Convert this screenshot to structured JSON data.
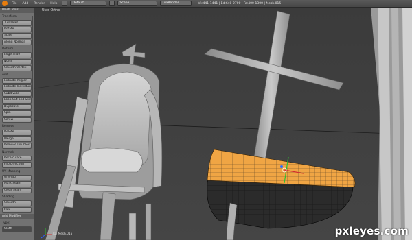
{
  "topbar": {
    "menus": [
      "File",
      "Add",
      "Render",
      "Help"
    ],
    "layout": "Default",
    "scene": "Scene",
    "engine": "LuxRender",
    "stats": "Ve:441-1441 | Ed:640-2700 | Fa:400-1300 | Mesh.015"
  },
  "toolshelf": {
    "title": "Mesh Tools",
    "sections": [
      {
        "label": "Transform",
        "buttons": [
          "Translate",
          "Rotate",
          "Scale",
          "Along Normal"
        ]
      },
      {
        "label": "Deform",
        "buttons": [
          "Edge Slide",
          "Noise",
          "Smooth Vertex"
        ]
      },
      {
        "label": "Add",
        "buttons": [
          "Extrude Region",
          "Extrude Individual",
          "Subdivide",
          "Loop Cut and Slide",
          "Duplicate",
          "Spin",
          "Screw"
        ]
      },
      {
        "label": "Remove",
        "buttons": [
          "Delete",
          "Merge",
          "Remove Doubles"
        ]
      },
      {
        "label": "Normals",
        "buttons": [
          "Recalculate",
          "Flip Direction"
        ]
      },
      {
        "label": "UV Mapping",
        "buttons": [
          "Unwrap",
          "Mark Seam",
          "Clear Seam"
        ]
      },
      {
        "label": "Shading",
        "buttons": [
          "Smooth",
          "Flat"
        ]
      }
    ],
    "panel2_title": "Add Modifier",
    "type_label": "Type:",
    "type_value": "Cloth"
  },
  "viewport": {
    "view_label": "User Ortho",
    "object_label": "(1) Mesh.015"
  },
  "watermark": "pxleyes.com"
}
